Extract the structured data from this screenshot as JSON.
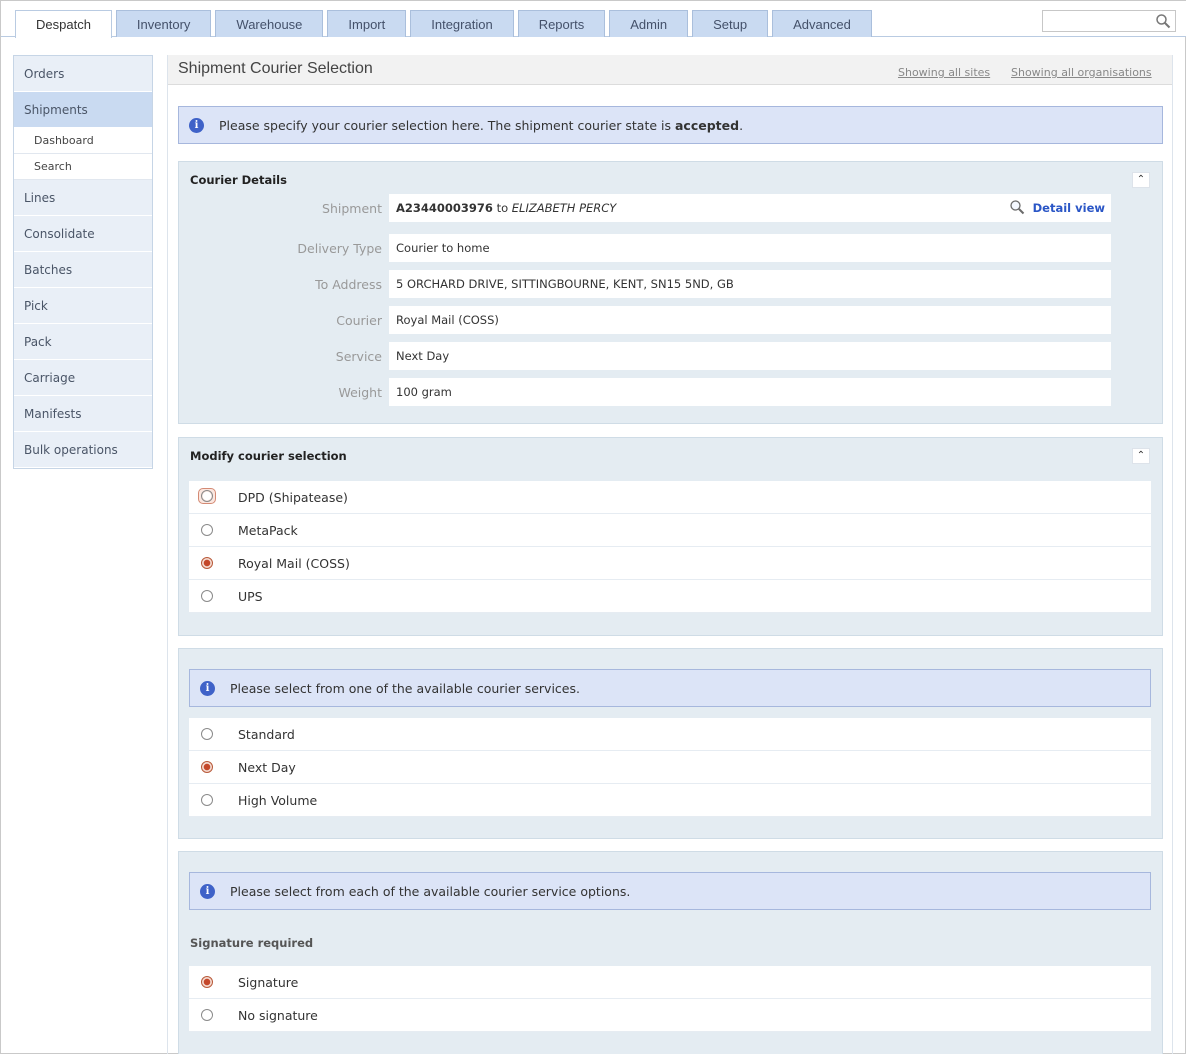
{
  "nav": {
    "tabs": [
      {
        "label": "Despatch"
      },
      {
        "label": "Inventory"
      },
      {
        "label": "Warehouse"
      },
      {
        "label": "Import"
      },
      {
        "label": "Integration"
      },
      {
        "label": "Reports"
      },
      {
        "label": "Admin"
      },
      {
        "label": "Setup"
      },
      {
        "label": "Advanced"
      }
    ],
    "active_tab": "Despatch",
    "search_value": ""
  },
  "sidebar": {
    "items": [
      {
        "label": "Orders"
      },
      {
        "label": "Shipments"
      },
      {
        "label": "Lines"
      },
      {
        "label": "Consolidate"
      },
      {
        "label": "Batches"
      },
      {
        "label": "Pick"
      },
      {
        "label": "Pack"
      },
      {
        "label": "Carriage"
      },
      {
        "label": "Manifests"
      },
      {
        "label": "Bulk operations"
      }
    ],
    "active_item": "Shipments",
    "sub_items": [
      {
        "label": "Dashboard"
      },
      {
        "label": "Search"
      }
    ]
  },
  "header": {
    "title": "Shipment Courier Selection",
    "showing_sites": "Showing all sites",
    "showing_orgs": "Showing all organisations"
  },
  "banner": {
    "text_prefix": "Please specify your courier selection here. The shipment courier state is ",
    "state": "accepted",
    "text_suffix": "."
  },
  "courier_details": {
    "title": "Courier Details",
    "shipment_label": "Shipment",
    "shipment_id": "A23440003976",
    "shipment_to": "to",
    "shipment_recipient": "ELIZABETH PERCY",
    "detail_view": "Detail view",
    "delivery_type_label": "Delivery Type",
    "delivery_type": "Courier to home",
    "address_label": "To Address",
    "address": "5 ORCHARD DRIVE, SITTINGBOURNE, KENT, SN15 5ND, GB",
    "courier_label": "Courier",
    "courier": "Royal Mail (COSS)",
    "service_label": "Service",
    "service": "Next Day",
    "weight_label": "Weight",
    "weight": "100 gram"
  },
  "modify": {
    "title": "Modify courier selection",
    "options": [
      {
        "label": "DPD (Shipatease)",
        "selected": false,
        "focused": true
      },
      {
        "label": "MetaPack",
        "selected": false
      },
      {
        "label": "Royal Mail (COSS)",
        "selected": true
      },
      {
        "label": "UPS",
        "selected": false
      }
    ]
  },
  "services": {
    "info": "Please select from one of the available courier services.",
    "options": [
      {
        "label": "Standard",
        "selected": false
      },
      {
        "label": "Next Day",
        "selected": true
      },
      {
        "label": "High Volume",
        "selected": false
      }
    ]
  },
  "service_options": {
    "info": "Please select from each of the available courier service options.",
    "group_label": "Signature required",
    "options": [
      {
        "label": "Signature",
        "selected": true
      },
      {
        "label": "No signature",
        "selected": false
      }
    ]
  },
  "colors": {
    "tab_bg": "#c9daf1",
    "info_bg": "#dce4f7",
    "panel_bg": "#e4ecf2",
    "link": "#2a56c6",
    "radio_checked": "#c4472a"
  }
}
